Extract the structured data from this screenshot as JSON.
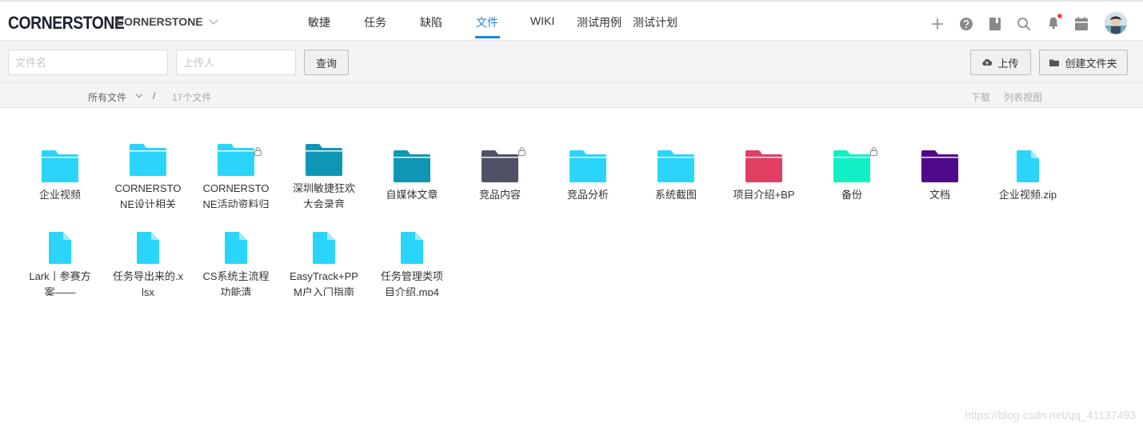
{
  "app": {
    "logo": "CORNERSTONE",
    "project": "CORNERSTONE"
  },
  "nav": {
    "items": [
      {
        "label": "敏捷"
      },
      {
        "label": "任务"
      },
      {
        "label": "缺陷"
      },
      {
        "label": "文件",
        "active": true
      },
      {
        "label": "WIKI"
      },
      {
        "label": "测试用例"
      },
      {
        "label": "测试计划"
      }
    ]
  },
  "top_icons": [
    "plus-icon",
    "help-icon",
    "book-icon",
    "search-icon",
    "bell-icon",
    "calendar-icon",
    "avatar"
  ],
  "toolbar": {
    "filename_placeholder": "文件名",
    "uploader_placeholder": "上传人",
    "query_label": "查询",
    "upload_label": "上传",
    "create_folder_label": "创建文件夹"
  },
  "breadcrumb": {
    "all_files": "所有文件",
    "separator": "/",
    "count": "17个文件",
    "download": "下载",
    "list_view": "列表视图"
  },
  "files": [
    {
      "name": "企业视频",
      "kind": "folder",
      "color": "#2ad4fb",
      "locked": false
    },
    {
      "name": "CORNERSTONE设计相关",
      "kind": "folder",
      "color": "#2ad4fb",
      "locked": false
    },
    {
      "name": "CORNERSTONE活动资料归档",
      "kind": "folder",
      "color": "#2ad4fb",
      "locked": true
    },
    {
      "name": "深圳敏捷狂欢大会录音",
      "kind": "folder",
      "color": "#0f96b4",
      "locked": false
    },
    {
      "name": "自媒体文章",
      "kind": "folder",
      "color": "#0f96b4",
      "locked": false
    },
    {
      "name": "竞品内容",
      "kind": "folder",
      "color": "#4f5264",
      "locked": true
    },
    {
      "name": "竞品分析",
      "kind": "folder",
      "color": "#2ad4fb",
      "locked": false
    },
    {
      "name": "系统截图",
      "kind": "folder",
      "color": "#2ad4fb",
      "locked": false
    },
    {
      "name": "项目介绍+BP",
      "kind": "folder",
      "color": "#e03f61",
      "locked": false
    },
    {
      "name": "备份",
      "kind": "folder",
      "color": "#11f0c5",
      "locked": true
    },
    {
      "name": "文档",
      "kind": "folder",
      "color": "#4e0a8a",
      "locked": false
    },
    {
      "name": "企业视频.zip",
      "kind": "file",
      "color": "#2ad4fb",
      "locked": false
    },
    {
      "name": "Lark丨参赛方案——",
      "kind": "file",
      "color": "#2ad4fb",
      "locked": false
    },
    {
      "name": "任务导出来的.xlsx",
      "kind": "file",
      "color": "#2ad4fb",
      "locked": false
    },
    {
      "name": "CS系统主流程功能清",
      "kind": "file",
      "color": "#2ad4fb",
      "locked": false
    },
    {
      "name": "EasyTrack+PPM户入门指南",
      "kind": "file",
      "color": "#2ad4fb",
      "locked": false
    },
    {
      "name": "任务管理类项目介绍.mp4",
      "kind": "file",
      "color": "#2ad4fb",
      "locked": false
    }
  ],
  "watermark": "https://blog.csdn.net/qq_41137493"
}
